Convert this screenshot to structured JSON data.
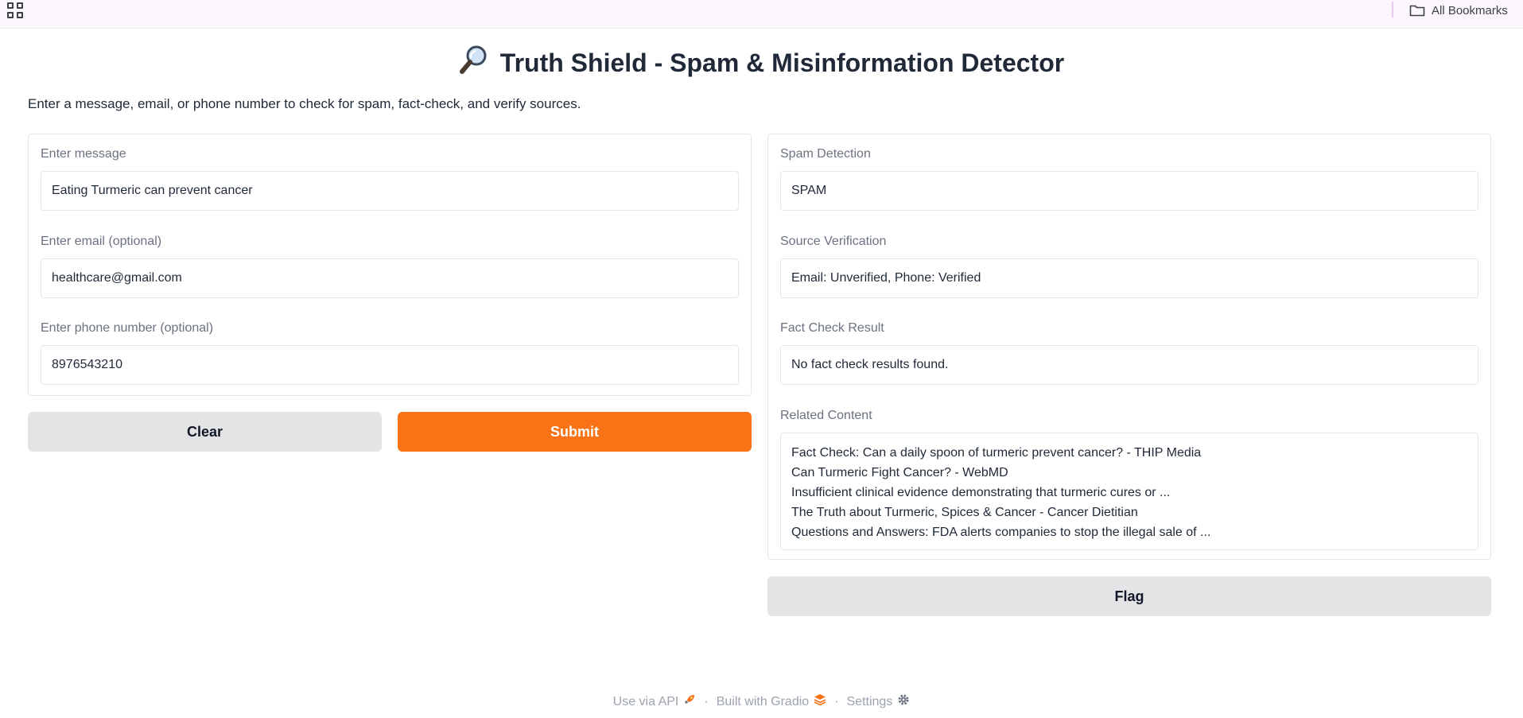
{
  "bookmarks_bar": {
    "all_bookmarks_label": "All Bookmarks"
  },
  "header": {
    "title": "Truth Shield - Spam & Misinformation Detector",
    "title_icon": "magnifying-glass-icon",
    "description": "Enter a message, email, or phone number to check for spam, fact-check, and verify sources."
  },
  "inputs": {
    "message": {
      "label": "Enter message",
      "value": "Eating Turmeric can prevent cancer"
    },
    "email": {
      "label": "Enter email (optional)",
      "value": "healthcare@gmail.com"
    },
    "phone": {
      "label": "Enter phone number (optional)",
      "value": "8976543210"
    }
  },
  "buttons": {
    "clear_label": "Clear",
    "submit_label": "Submit",
    "flag_label": "Flag"
  },
  "outputs": {
    "spam": {
      "label": "Spam Detection",
      "value": "SPAM"
    },
    "source": {
      "label": "Source Verification",
      "value": "Email: Unverified, Phone: Verified"
    },
    "fact_check": {
      "label": "Fact Check Result",
      "value": "No fact check results found."
    },
    "related": {
      "label": "Related Content",
      "items": [
        "Fact Check: Can a daily spoon of turmeric prevent cancer? - THIP Media",
        "Can Turmeric Fight Cancer? - WebMD",
        "Insufficient clinical evidence demonstrating that turmeric cures or ...",
        "The Truth about Turmeric, Spices & Cancer - Cancer Dietitian",
        "Questions and Answers: FDA alerts companies to stop the illegal sale of ..."
      ]
    }
  },
  "footer": {
    "api_label": "Use via API",
    "gradio_label": "Built with Gradio",
    "settings_label": "Settings",
    "separator": "·"
  },
  "colors": {
    "accent": "#f97316",
    "secondary_button": "#e4e4e7",
    "bookmarks_bar": "#fcf7fd"
  }
}
